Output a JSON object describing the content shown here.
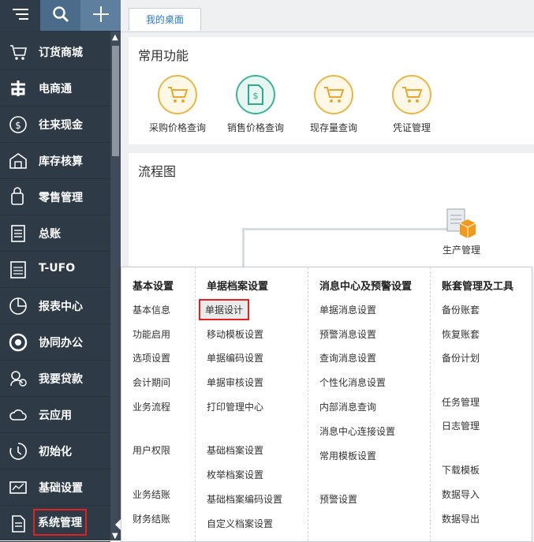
{
  "topbar": {
    "menu_icon": "menu-icon",
    "search_icon": "search-icon",
    "add_icon": "plus-icon"
  },
  "sidebar": {
    "items": [
      {
        "label": "订货商城",
        "icon": "cart-icon"
      },
      {
        "label": "电商通",
        "icon": "ecommerce-icon"
      },
      {
        "label": "往来现金",
        "icon": "cash-icon"
      },
      {
        "label": "库存核算",
        "icon": "warehouse-icon"
      },
      {
        "label": "零售管理",
        "icon": "retail-icon"
      },
      {
        "label": "总账",
        "icon": "ledger-icon"
      },
      {
        "label": "T-UFO",
        "icon": "tufo-icon"
      },
      {
        "label": "报表中心",
        "icon": "report-icon"
      },
      {
        "label": "协同办公",
        "icon": "office-icon"
      },
      {
        "label": "我要贷款",
        "icon": "loan-icon"
      },
      {
        "label": "云应用",
        "icon": "cloud-icon"
      },
      {
        "label": "初始化",
        "icon": "init-icon"
      },
      {
        "label": "基础设置",
        "icon": "settings-icon"
      },
      {
        "label": "系统管理",
        "icon": "system-icon"
      }
    ]
  },
  "tabs": {
    "desktop": "我的桌面"
  },
  "common": {
    "title": "常用功能",
    "items": [
      {
        "label": "采购价格查询"
      },
      {
        "label": "销售价格查询"
      },
      {
        "label": "现存量查询"
      },
      {
        "label": "凭证管理"
      }
    ]
  },
  "flow": {
    "title": "流程图",
    "production_label": "生产管理"
  },
  "menu": {
    "columns": [
      {
        "title": "基本设置",
        "items": [
          "基本信息",
          "功能启用",
          "选项设置",
          "会计期间",
          "业务流程",
          "用户权限",
          "业务结账",
          "财务结账"
        ]
      },
      {
        "title": "单据档案设置",
        "items": [
          "单据设计",
          "移动模板设置",
          "单据编码设置",
          "单据审核设置",
          "打印管理中心",
          "基础档案设置",
          "枚举档案设置",
          "基础档案编码设置",
          "自定义档案设置"
        ]
      },
      {
        "title": "消息中心及预警设置",
        "items": [
          "单据消息设置",
          "预警消息设置",
          "查询消息设置",
          "个性化消息设置",
          "内部消息查询",
          "消息中心连接设置",
          "常用模板设置",
          "预警设置"
        ]
      },
      {
        "title": "账套管理及工具",
        "items": [
          "备份账套",
          "恢复账套",
          "备份计划",
          "任务管理",
          "日志管理",
          "下载模板",
          "数据导入",
          "数据导出"
        ]
      }
    ]
  },
  "colors": {
    "sidebar_bg": "#2e3a46",
    "accent": "#2a7bd0",
    "highlight": "#e02222"
  }
}
